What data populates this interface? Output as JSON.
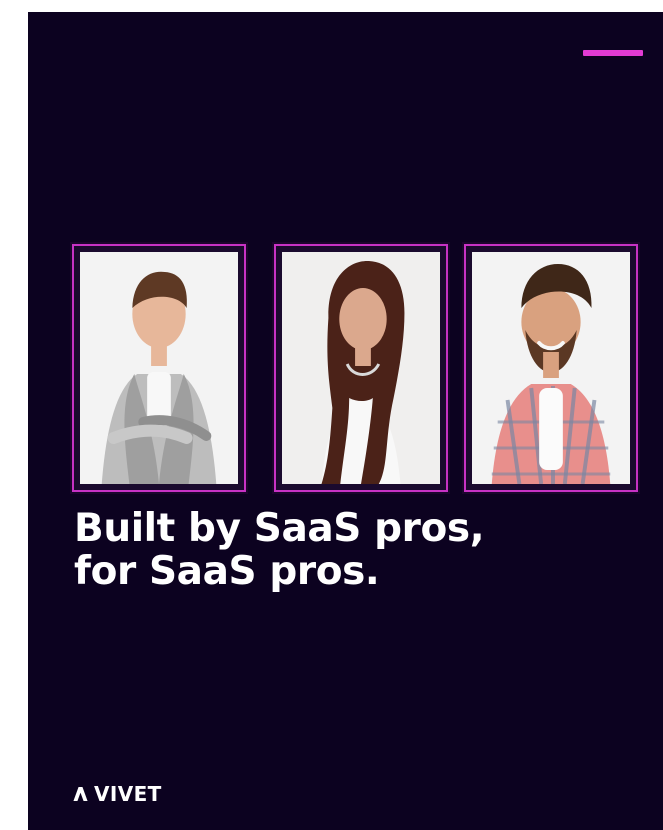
{
  "headline": {
    "line1": "Built by SaaS pros,",
    "line2": "for SaaS pros."
  },
  "brand": {
    "name": "VIVET"
  },
  "colors": {
    "background": "#0c0220",
    "accent": "#e23bd3",
    "frame": "#c732c4"
  },
  "photos": [
    {
      "name": "person-1"
    },
    {
      "name": "person-2"
    },
    {
      "name": "person-3"
    }
  ]
}
